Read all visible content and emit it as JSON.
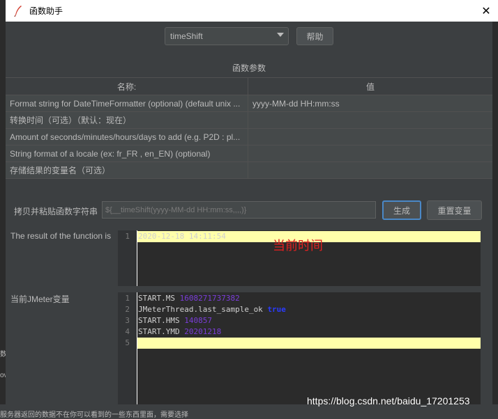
{
  "window": {
    "title": "函数助手"
  },
  "toolbar": {
    "function_select": "timeShift",
    "help_label": "帮助"
  },
  "params": {
    "section_title": "函数参数",
    "col_name": "名称:",
    "col_value": "值",
    "rows": [
      {
        "name": "Format string for DateTimeFormatter (optional) (default unix ...",
        "value": "yyyy-MM-dd HH:mm:ss"
      },
      {
        "name": "转换时间（可选）（默认：现在）",
        "value": ""
      },
      {
        "name": "Amount of seconds/minutes/hours/days to add (e.g. P2D : pl...",
        "value": ""
      },
      {
        "name": "String format of a locale (ex: fr_FR , en_EN) (optional)",
        "value": ""
      },
      {
        "name": "存储结果的变量名（可选）",
        "value": ""
      }
    ]
  },
  "copy": {
    "label": "拷贝并粘贴函数字符串",
    "value": "${__timeShift(yyyy-MM-dd HH:mm:ss,,,,)}",
    "generate_label": "生成",
    "reset_label": "重置变量"
  },
  "result": {
    "label": "The result of the function is",
    "lines": [
      {
        "num": "1",
        "text": "2020-12-18 14:11:54"
      }
    ],
    "annotation": "当前时间"
  },
  "vars": {
    "label": "当前JMeter变量",
    "lines": [
      {
        "num": "1",
        "key": "START.MS ",
        "val": "1608271737382"
      },
      {
        "num": "2",
        "key": "JMeterThread.last_sample_ok ",
        "val": "true"
      },
      {
        "num": "3",
        "key": "START.HMS ",
        "val": "140857"
      },
      {
        "num": "4",
        "key": "START.YMD ",
        "val": "20201218"
      },
      {
        "num": "5",
        "key": "",
        "val": ""
      }
    ]
  },
  "watermark": "https://blog.csdn.net/baidu_17201253",
  "background": {
    "left_stub_1": "数",
    "left_stub_2": "ov",
    "bottom_text": "服务器返回的数据不在你可以看到的一些东西里面，需要选择"
  }
}
